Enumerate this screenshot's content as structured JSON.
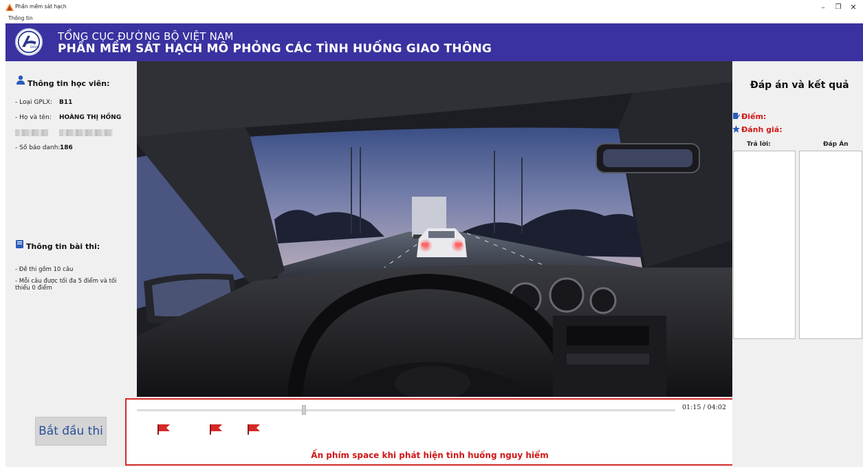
{
  "window": {
    "title": "Phần mềm sát hạch",
    "menu_item": "Thông tin",
    "minimize": "–",
    "maximize": "❐",
    "close": "✕"
  },
  "header": {
    "line1": "TỔNG CỤC ĐƯỜNG BỘ VIỆT NAM",
    "line2": "PHẦN MỀM SÁT HẠCH MÔ PHỎNG CÁC TÌNH HUỐNG GIAO THÔNG",
    "logo_text": "DRVN",
    "color": "#3a32a0"
  },
  "student": {
    "section_title": "Thông tin học viên:",
    "license_label": "- Loại GPLX:",
    "license_value": "B11",
    "name_label": "- Họ và tên:",
    "name_value": "HOÀNG THỊ HỒNG",
    "id_label": "- Số báo danh:",
    "id_value": "186"
  },
  "exam": {
    "section_title": "Thông tin bài thi:",
    "line1": "- Đề thi gồm 10 câu",
    "line2a": "- Mỗi câu được tối đa 5 điểm và tối",
    "line2b": "thiểu 0 điểm"
  },
  "start_button": "Bắt đầu thi",
  "player": {
    "time": "01:15 / 04:02",
    "progress": 0.31,
    "flags": 3,
    "hint": "Ấn phím space khi phát hiện tình huống nguy hiểm",
    "accent": "#d32a2a"
  },
  "results": {
    "title": "Đáp án và kết quả",
    "score_label": "Điểm:",
    "rating_label": "Đánh giá:",
    "answer_col": "Trả lời:",
    "key_col": "Đáp Án"
  }
}
